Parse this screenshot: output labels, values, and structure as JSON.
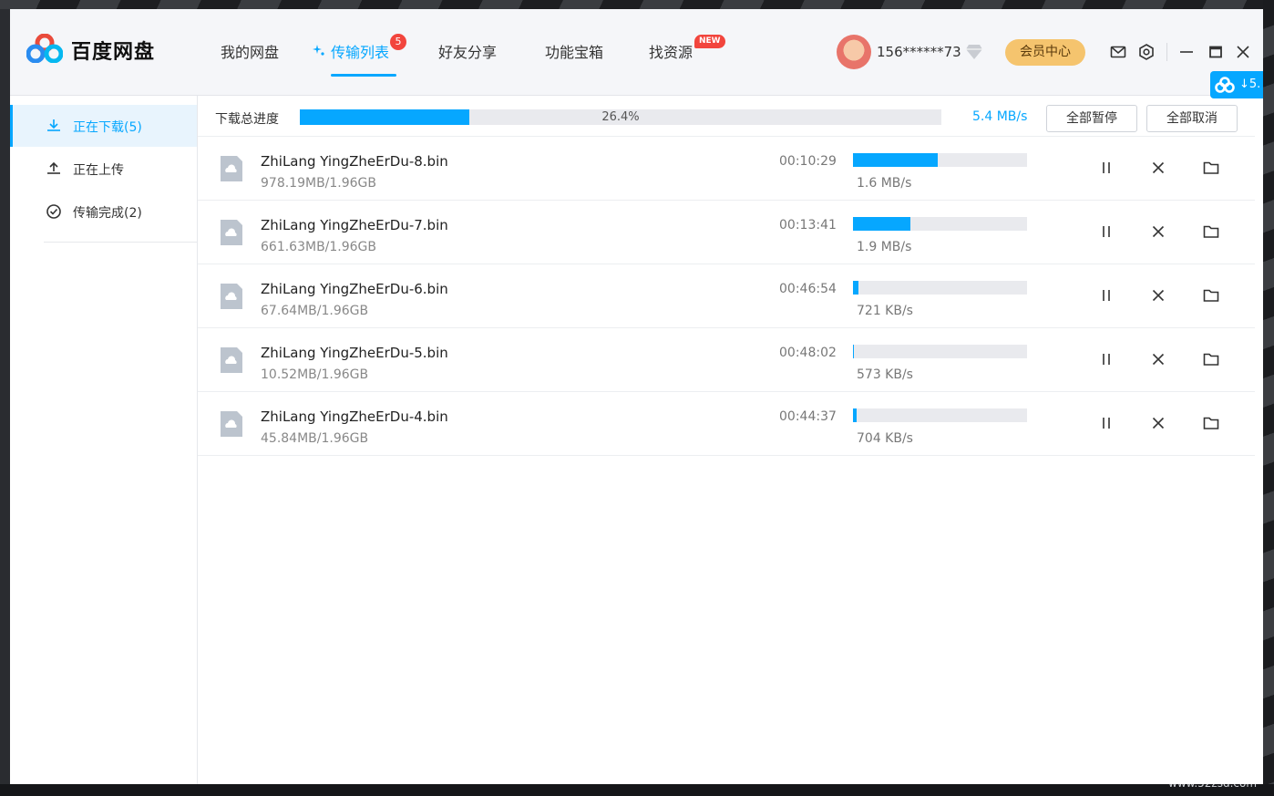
{
  "app": {
    "title": "百度网盘"
  },
  "nav": {
    "tabs": [
      {
        "label": "我的网盘"
      },
      {
        "label": "传输列表",
        "badge": "5"
      },
      {
        "label": "好友分享"
      },
      {
        "label": "功能宝箱"
      },
      {
        "label": "找资源",
        "badge": "NEW"
      }
    ],
    "active_index": 1
  },
  "user": {
    "name": "156******73",
    "vip_label": "会员中心"
  },
  "float_widget": {
    "text": "↓5."
  },
  "sidebar": {
    "items": [
      {
        "label": "正在下载(5)",
        "icon": "download-icon"
      },
      {
        "label": "正在上传",
        "icon": "upload-icon"
      },
      {
        "label": "传输完成(2)",
        "icon": "check-circle-icon"
      }
    ]
  },
  "summary": {
    "label": "下载总进度",
    "percent_text": "26.4%",
    "progress": 0.264,
    "speed": "5.4 MB/s",
    "pause_all": "全部暂停",
    "cancel_all": "全部取消"
  },
  "downloads": [
    {
      "name": "ZhiLang YingZheErDu-8.bin",
      "size": "978.19MB/1.96GB",
      "time": "00:10:29",
      "speed": "1.6 MB/s",
      "progress": 0.487
    },
    {
      "name": "ZhiLang YingZheErDu-7.bin",
      "size": "661.63MB/1.96GB",
      "time": "00:13:41",
      "speed": "1.9 MB/s",
      "progress": 0.33
    },
    {
      "name": "ZhiLang YingZheErDu-6.bin",
      "size": "67.64MB/1.96GB",
      "time": "00:46:54",
      "speed": "721 KB/s",
      "progress": 0.034
    },
    {
      "name": "ZhiLang YingZheErDu-5.bin",
      "size": "10.52MB/1.96GB",
      "time": "00:48:02",
      "speed": "573 KB/s",
      "progress": 0.005
    },
    {
      "name": "ZhiLang YingZheErDu-4.bin",
      "size": "45.84MB/1.96GB",
      "time": "00:44:37",
      "speed": "704 KB/s",
      "progress": 0.023
    }
  ],
  "icons": {
    "row": [
      "pause-icon",
      "close-icon",
      "folder-icon"
    ],
    "window": [
      "mail-icon",
      "settings-icon",
      "minimize-icon",
      "maximize-icon",
      "close-icon"
    ]
  },
  "colors": {
    "accent": "#06a7ff",
    "badge": "#f2453d",
    "vip": "#f5c46e"
  },
  "watermark": "www.52zsd.com"
}
